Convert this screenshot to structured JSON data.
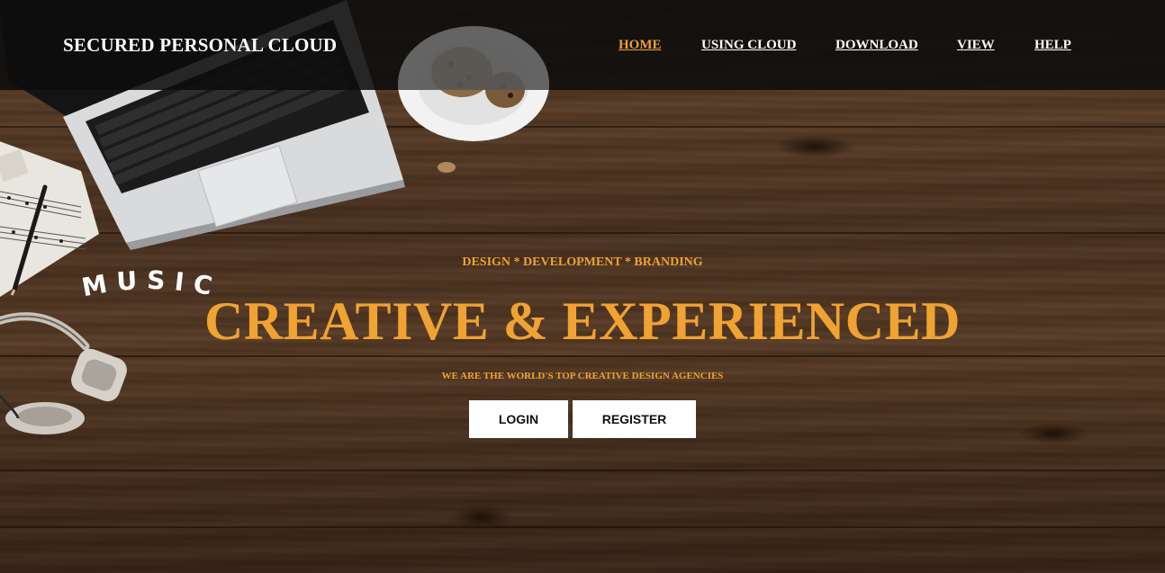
{
  "brand": {
    "title": "SECURED PERSONAL CLOUD"
  },
  "nav": {
    "items": [
      {
        "label": "HOME",
        "active": true
      },
      {
        "label": "USING CLOUD",
        "active": false
      },
      {
        "label": "DOWNLOAD",
        "active": false
      },
      {
        "label": "VIEW",
        "active": false
      },
      {
        "label": "HELP",
        "active": false
      }
    ]
  },
  "hero": {
    "tagline": "DESIGN * DEVELOPMENT * BRANDING",
    "headline": "CREATIVE & EXPERIENCED",
    "subline": "WE ARE THE WORLD'S TOP CREATIVE DESIGN AGENCIES",
    "decor_word": "MUSIC",
    "login_label": "LOGIN",
    "register_label": "REGISTER"
  },
  "colors": {
    "accent": "#f0a232",
    "header_bg": "#0c0c0c",
    "button_bg": "#ffffff",
    "wood": "#4d3422"
  },
  "icons": [
    "laptop-icon",
    "cookie-plate-icon",
    "headphones-icon",
    "sheet-music-icon",
    "pencil-icon"
  ]
}
